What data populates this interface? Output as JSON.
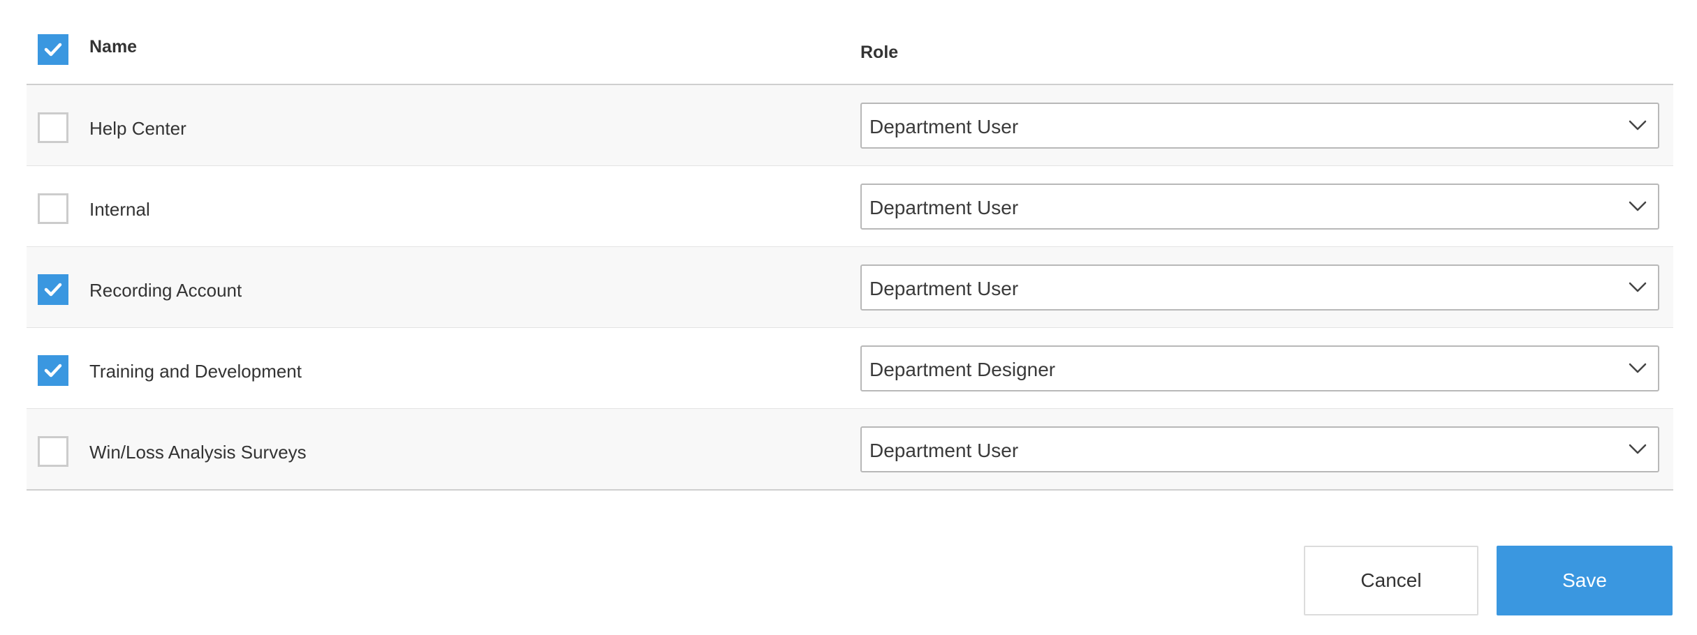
{
  "table": {
    "select_all_checked": true,
    "headers": {
      "name": "Name",
      "role": "Role"
    },
    "rows": [
      {
        "name": "Help Center",
        "role": "Department User",
        "checked": false
      },
      {
        "name": "Internal",
        "role": "Department User",
        "checked": false
      },
      {
        "name": "Recording Account",
        "role": "Department User",
        "checked": true
      },
      {
        "name": "Training and Development",
        "role": "Department Designer",
        "checked": true
      },
      {
        "name": "Win/Loss Analysis Surveys",
        "role": "Department User",
        "checked": false
      }
    ]
  },
  "icons": {
    "checkbox_mark": "checkmark-icon",
    "select_arrow": "chevron-down-icon"
  },
  "colors": {
    "accent": "#3a97e0",
    "row_alt": "#f8f8f8"
  },
  "actions": {
    "cancel_label": "Cancel",
    "save_label": "Save"
  }
}
